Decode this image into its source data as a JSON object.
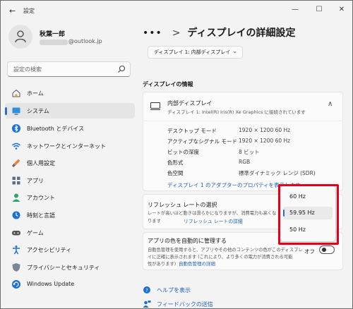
{
  "window": {
    "title": "設定",
    "back_glyph": "←",
    "min_glyph": "—",
    "max_glyph": "☐",
    "close_glyph": "✕"
  },
  "user": {
    "name": "秋葉一郎",
    "email": "@outlook.jp"
  },
  "search": {
    "placeholder": "設定の検索"
  },
  "sidebar": {
    "items": [
      {
        "label": "ホーム",
        "icon": "home-icon",
        "active": false
      },
      {
        "label": "システム",
        "icon": "system-icon",
        "active": true
      },
      {
        "label": "Bluetooth とデバイス",
        "icon": "bluetooth-icon",
        "active": false
      },
      {
        "label": "ネットワークとインターネット",
        "icon": "wifi-icon",
        "active": false
      },
      {
        "label": "個人用設定",
        "icon": "paintbrush-icon",
        "active": false
      },
      {
        "label": "アプリ",
        "icon": "apps-icon",
        "active": false
      },
      {
        "label": "アカウント",
        "icon": "account-icon",
        "active": false
      },
      {
        "label": "時刻と言語",
        "icon": "clock-icon",
        "active": false
      },
      {
        "label": "ゲーム",
        "icon": "game-icon",
        "active": false
      },
      {
        "label": "アクセシビリティ",
        "icon": "accessibility-icon",
        "active": false
      },
      {
        "label": "プライバシーとセキュリティ",
        "icon": "shield-icon",
        "active": false
      },
      {
        "label": "Windows Update",
        "icon": "update-icon",
        "active": false
      }
    ]
  },
  "breadcrumb": {
    "dots": "•••",
    "chevron": ">",
    "title": "ディスプレイの詳細設定"
  },
  "display_select": {
    "value": "ディスプレイ 1: 内部ディスプレイ",
    "chevron": "⌄"
  },
  "display_info": {
    "heading": "ディスプレイの情報",
    "card_title": "内部ディスプレイ",
    "card_subtitle": "ディスプレイ 1: Intel(R) Iris(R) Xe Graphics に接続されています",
    "chevron": "∧",
    "rows": [
      {
        "key": "デスクトップ モード",
        "value": "1920 × 1200 60 Hz"
      },
      {
        "key": "アクティブなシグナル モード",
        "value": "1920 × 1200 60 Hz"
      },
      {
        "key": "ビットの深度",
        "value": "8 ビット"
      },
      {
        "key": "色形式",
        "value": "RGB"
      },
      {
        "key": "色空間",
        "value": "標準ダイナミック レンジ (SDR)"
      }
    ],
    "adapter_link": "ディスプレイ 1 のアダプターのプロパティを表示します"
  },
  "refresh_rate": {
    "title": "リフレッシュ レートの選択",
    "desc": "レートが高いほど動きは滑らかになりますが、消費電力も高くな",
    "desc_line2": "ります",
    "link": "リフレッシュ レートの詳細",
    "options": [
      "60 Hz",
      "59.95 Hz",
      "50 Hz"
    ],
    "selected": "59.95 Hz"
  },
  "auto_color": {
    "title": "アプリの色を自動的に管理する",
    "desc_lines": [
      "自動色管理を使用すると、アプリやその他のコンテンツの色がこのディスプレ",
      "イに正確に表示されます (これにより、より多くの電力が消費される可能",
      "性があります)"
    ],
    "link": "自動色管理の詳細",
    "toggle_label": "オフ",
    "toggle_on": false
  },
  "help": {
    "get_help": "ヘルプを表示",
    "feedback": "フィードバックの送信"
  },
  "colors": {
    "accent": "#2f6bd6",
    "link": "#1f5fb8",
    "highlight_box": "#e4001b"
  }
}
